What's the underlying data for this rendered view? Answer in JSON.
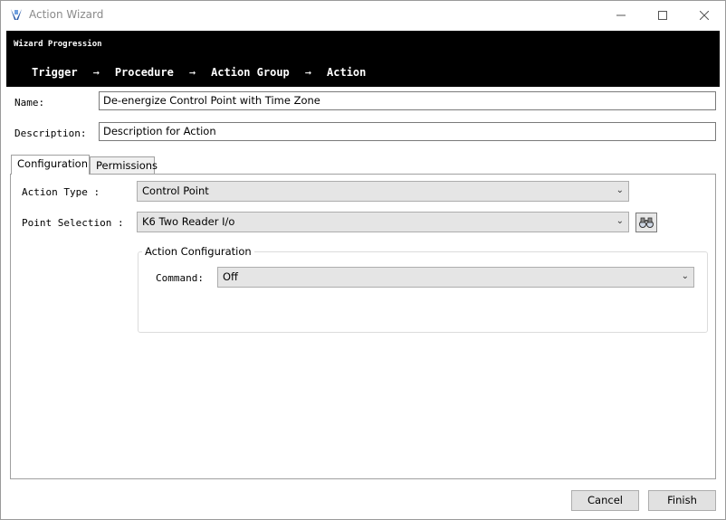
{
  "window": {
    "title": "Action Wizard"
  },
  "wizard": {
    "heading": "Wizard Progression",
    "steps": [
      "Trigger",
      "Procedure",
      "Action Group",
      "Action"
    ],
    "arrow": "→"
  },
  "form": {
    "name_label": "Name:",
    "name_value": "De-energize Control Point with Time Zone",
    "description_label": "Description:",
    "description_value": "Description for Action"
  },
  "tabs": [
    {
      "label": "Configuration",
      "selected": true
    },
    {
      "label": "Permissions",
      "selected": false
    }
  ],
  "configuration": {
    "action_type_label": "Action Type :",
    "action_type_value": "Control Point",
    "point_selection_label": "Point Selection :",
    "point_selection_value": "K6 Two Reader I/o",
    "group_title": "Action Configuration",
    "command_label": "Command:",
    "command_value": "Off"
  },
  "buttons": {
    "cancel": "Cancel",
    "finish": "Finish"
  },
  "icons": {
    "app": "action-wizard-icon",
    "minimize": "minimize-icon",
    "maximize": "maximize-icon",
    "close": "close-icon",
    "browse": "binoculars-icon",
    "dropdown": "chevron-down-icon"
  }
}
